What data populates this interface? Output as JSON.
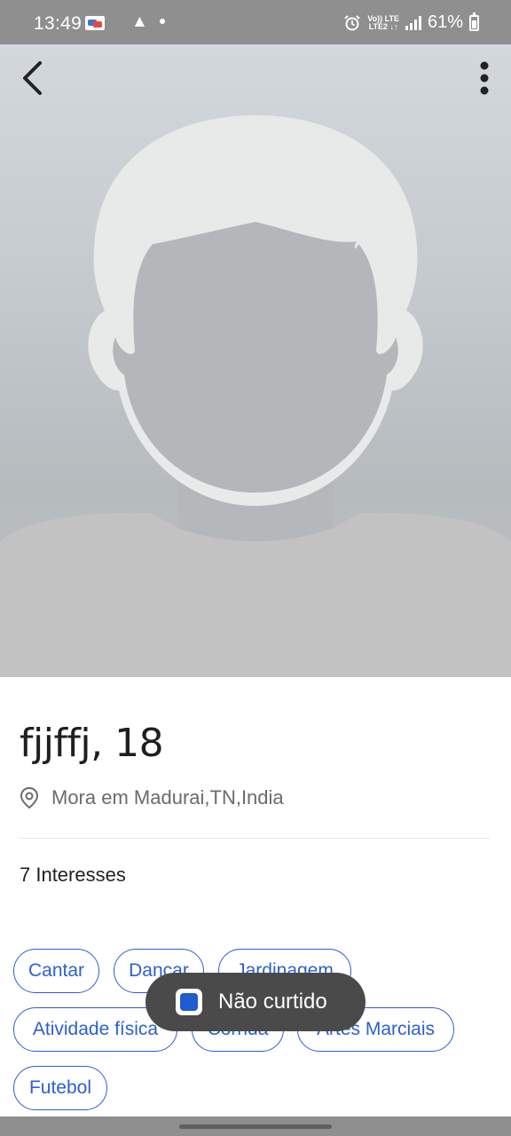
{
  "status_bar": {
    "time": "13:49",
    "alert_symbol": "▲",
    "alarm_icon": "alarm-icon",
    "net_top": "Vo)) LTE",
    "net_bottom": "LTE2 ↓↑",
    "battery": "61%"
  },
  "header": {
    "back_icon": "chevron-left-icon",
    "menu_icon": "more-vert-icon"
  },
  "profile": {
    "name_age": "fjjffj, 18",
    "location": "Mora em Madurai,TN,India",
    "location_icon": "location-pin-icon",
    "interests_title": "7 Interesses",
    "interests": [
      "Cantar",
      "Dançar",
      "Jardinagem",
      "Atividade física",
      "Corrida",
      "Artes Marciais",
      "Futebol"
    ]
  },
  "toast": {
    "label": "Não curtido",
    "icon": "app-icon"
  },
  "colors": {
    "accent": "#2c5fd0",
    "toast_bg": "#4a4a4a",
    "status_bar": "#8f8f8f"
  }
}
